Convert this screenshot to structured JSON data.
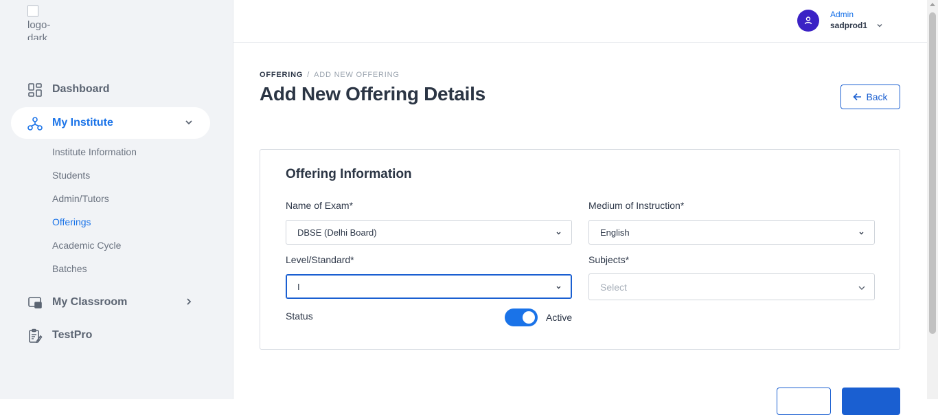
{
  "logo": {
    "alt_text": "logo-dark"
  },
  "sidebar": {
    "items": [
      {
        "label": "Dashboard"
      },
      {
        "label": "My Institute"
      },
      {
        "label": "My Classroom"
      },
      {
        "label": "TestPro"
      }
    ],
    "sub_items": [
      {
        "label": "Institute Information"
      },
      {
        "label": "Students"
      },
      {
        "label": "Admin/Tutors"
      },
      {
        "label": "Offerings"
      },
      {
        "label": "Academic Cycle"
      },
      {
        "label": "Batches"
      }
    ]
  },
  "user": {
    "role": "Admin",
    "name": "sadprod1"
  },
  "breadcrumb": {
    "root": "OFFERING",
    "separator": "/",
    "current": "ADD NEW OFFERING"
  },
  "page": {
    "title": "Add New Offering Details",
    "back_label": "Back"
  },
  "form": {
    "section_title": "Offering Information",
    "exam": {
      "label": "Name of Exam*",
      "value": "DBSE (Delhi Board)"
    },
    "medium": {
      "label": "Medium of Instruction*",
      "value": "English"
    },
    "level": {
      "label": "Level/Standard*",
      "value": "I"
    },
    "subjects": {
      "label": "Subjects*",
      "placeholder": "Select"
    },
    "status": {
      "label": "Status",
      "value": "Active",
      "enabled": true
    }
  },
  "colors": {
    "accent": "#1a73e8",
    "avatar": "#3b22c5",
    "sidebar_bg": "#f1f3f6"
  }
}
